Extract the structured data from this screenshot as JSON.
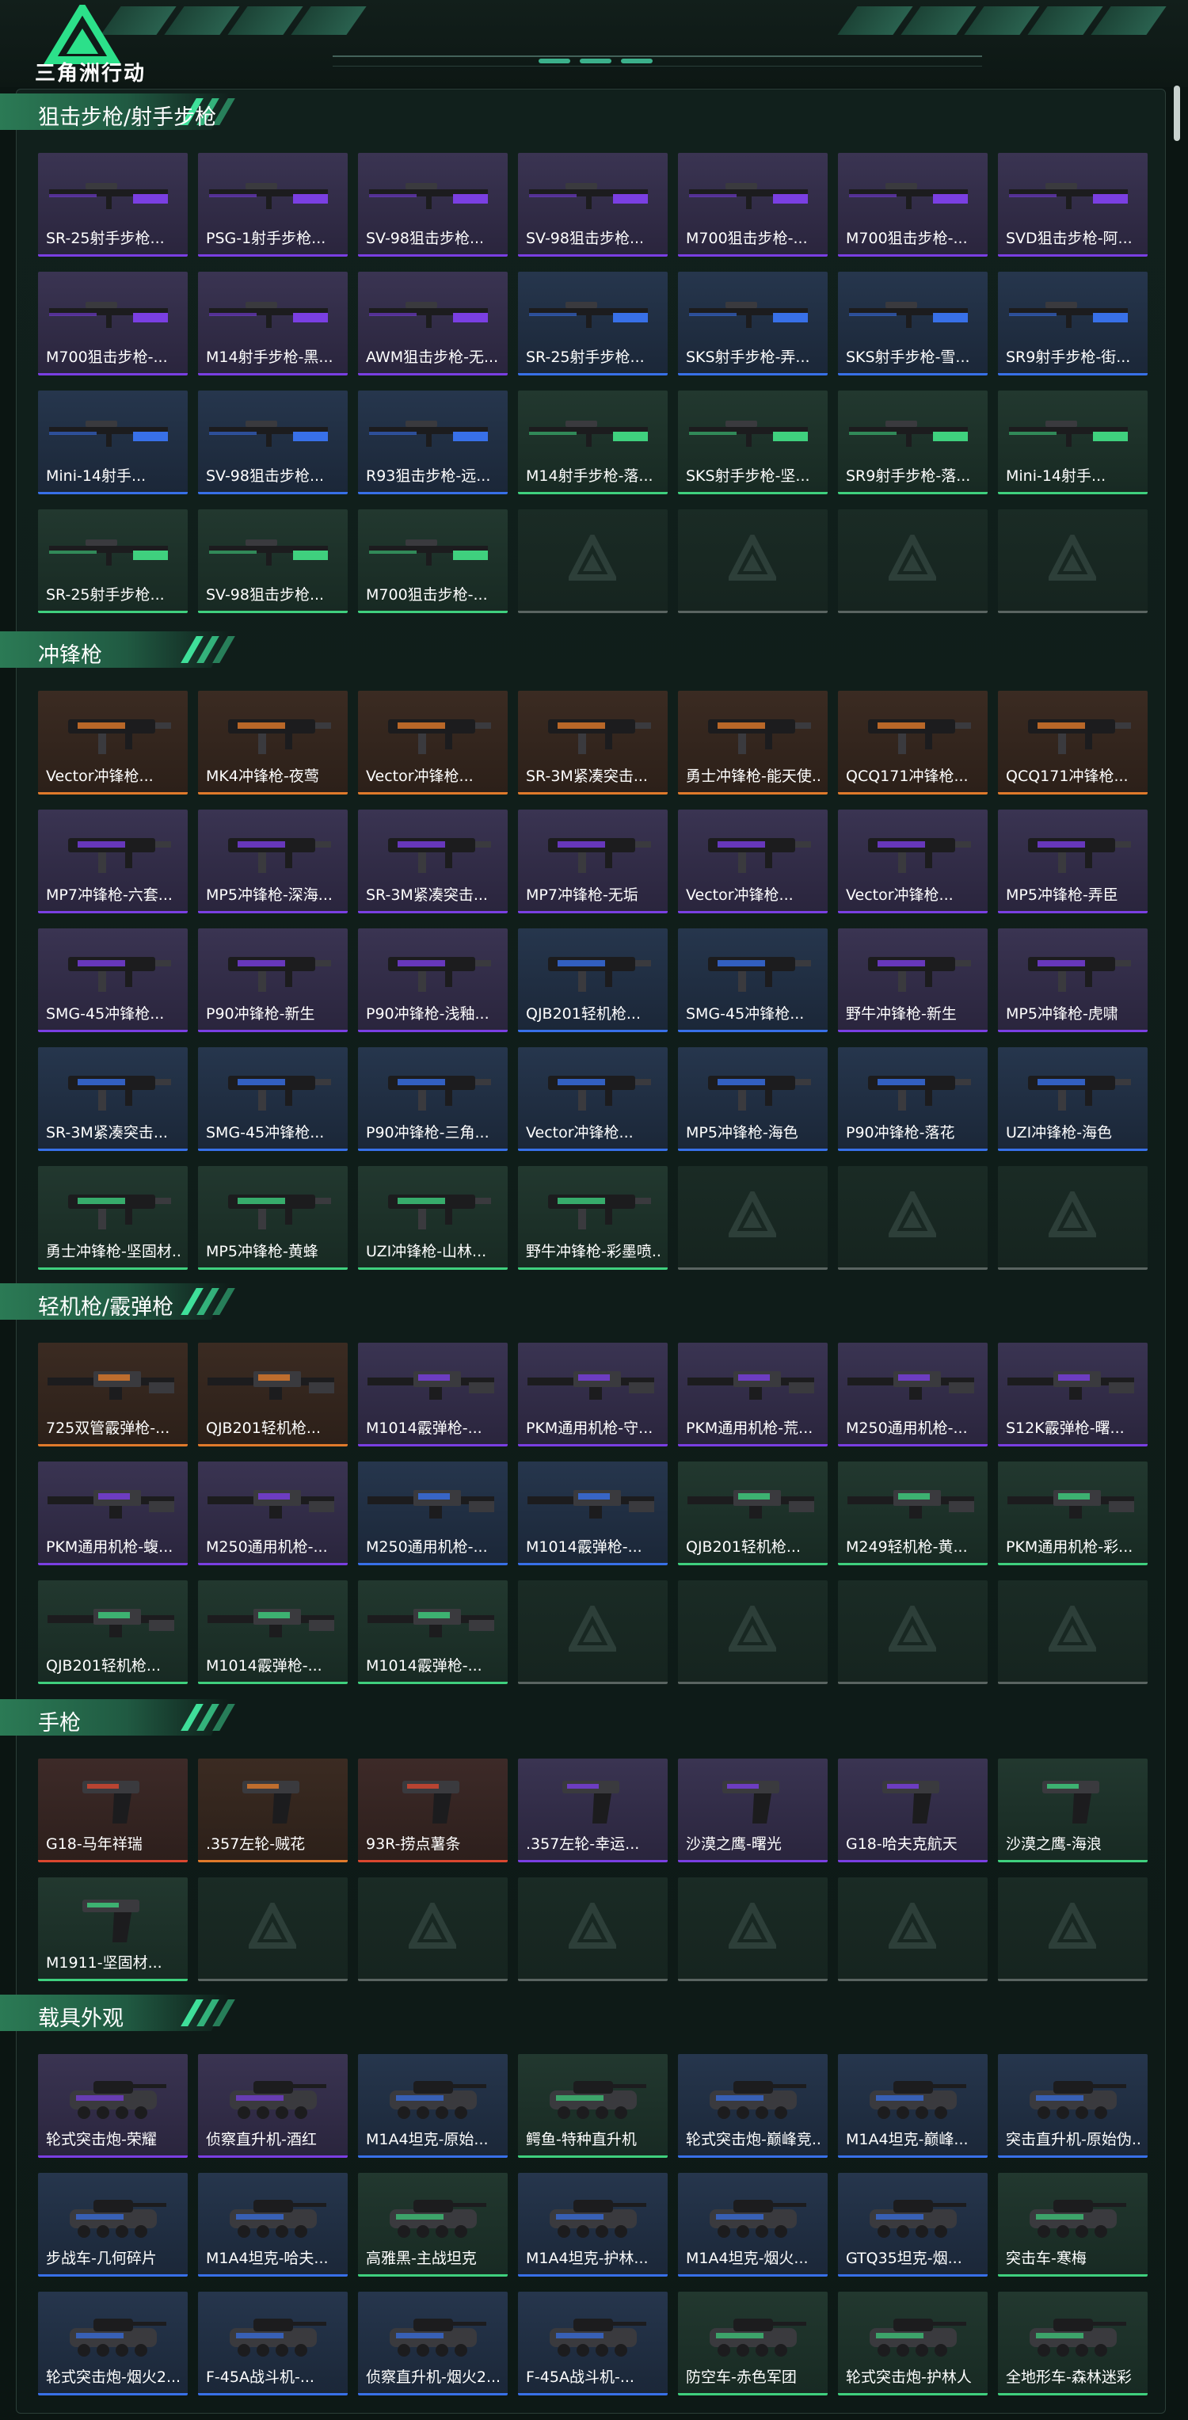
{
  "header": {
    "game_title": "三角洲行动",
    "logo_icon": "delta-logo-icon"
  },
  "sections": [
    {
      "title": "狙击步枪/射手步枪",
      "kind": "rifle",
      "columns": 7,
      "rows": 4,
      "items": [
        {
          "name": "SR-25射手步枪...",
          "rarity": "purple"
        },
        {
          "name": "PSG-1射手步枪...",
          "rarity": "purple"
        },
        {
          "name": "SV-98狙击步枪...",
          "rarity": "purple"
        },
        {
          "name": "SV-98狙击步枪...",
          "rarity": "purple"
        },
        {
          "name": "M700狙击步枪-...",
          "rarity": "purple"
        },
        {
          "name": "M700狙击步枪-...",
          "rarity": "purple"
        },
        {
          "name": "SVD狙击步枪-阿...",
          "rarity": "purple"
        },
        {
          "name": "M700狙击步枪-...",
          "rarity": "purple"
        },
        {
          "name": "M14射手步枪-黑...",
          "rarity": "purple"
        },
        {
          "name": "AWM狙击步枪-无...",
          "rarity": "purple"
        },
        {
          "name": "SR-25射手步枪...",
          "rarity": "blue"
        },
        {
          "name": "SKS射手步枪-弄...",
          "rarity": "blue"
        },
        {
          "name": "SKS射手步枪-雪...",
          "rarity": "blue"
        },
        {
          "name": "SR9射手步枪-街...",
          "rarity": "blue"
        },
        {
          "name": "Mini-14射手...",
          "rarity": "blue"
        },
        {
          "name": "SV-98狙击步枪...",
          "rarity": "blue"
        },
        {
          "name": "R93狙击步枪-远...",
          "rarity": "blue"
        },
        {
          "name": "M14射手步枪-落...",
          "rarity": "green"
        },
        {
          "name": "SKS射手步枪-坚...",
          "rarity": "green"
        },
        {
          "name": "SR9射手步枪-落...",
          "rarity": "green"
        },
        {
          "name": "Mini-14射手...",
          "rarity": "green"
        },
        {
          "name": "SR-25射手步枪...",
          "rarity": "green"
        },
        {
          "name": "SV-98狙击步枪...",
          "rarity": "green"
        },
        {
          "name": "M700狙击步枪-...",
          "rarity": "green"
        }
      ]
    },
    {
      "title": "冲锋枪",
      "kind": "smg",
      "columns": 7,
      "rows": 5,
      "items": [
        {
          "name": "Vector冲锋枪...",
          "rarity": "orange"
        },
        {
          "name": "MK4冲锋枪-夜莺",
          "rarity": "orange"
        },
        {
          "name": "Vector冲锋枪...",
          "rarity": "orange"
        },
        {
          "name": "SR-3M紧凑突击...",
          "rarity": "orange"
        },
        {
          "name": "勇士冲锋枪-能天使...",
          "rarity": "orange"
        },
        {
          "name": "QCQ171冲锋枪...",
          "rarity": "orange"
        },
        {
          "name": "QCQ171冲锋枪...",
          "rarity": "orange"
        },
        {
          "name": "MP7冲锋枪-六套...",
          "rarity": "purple"
        },
        {
          "name": "MP5冲锋枪-深海...",
          "rarity": "purple"
        },
        {
          "name": "SR-3M紧凑突击...",
          "rarity": "purple"
        },
        {
          "name": "MP7冲锋枪-无垢",
          "rarity": "purple"
        },
        {
          "name": "Vector冲锋枪...",
          "rarity": "purple"
        },
        {
          "name": "Vector冲锋枪...",
          "rarity": "purple"
        },
        {
          "name": "MP5冲锋枪-弄臣",
          "rarity": "purple"
        },
        {
          "name": "SMG-45冲锋枪...",
          "rarity": "purple"
        },
        {
          "name": "P90冲锋枪-新生",
          "rarity": "purple"
        },
        {
          "name": "P90冲锋枪-浅釉...",
          "rarity": "purple"
        },
        {
          "name": "QJB201轻机枪...",
          "rarity": "blue"
        },
        {
          "name": "SMG-45冲锋枪...",
          "rarity": "blue"
        },
        {
          "name": "野牛冲锋枪-新生",
          "rarity": "purple"
        },
        {
          "name": "MP5冲锋枪-虎啸",
          "rarity": "purple"
        },
        {
          "name": "SR-3M紧凑突击...",
          "rarity": "blue"
        },
        {
          "name": "SMG-45冲锋枪...",
          "rarity": "blue"
        },
        {
          "name": "P90冲锋枪-三角...",
          "rarity": "blue"
        },
        {
          "name": "Vector冲锋枪...",
          "rarity": "blue"
        },
        {
          "name": "MP5冲锋枪-海色",
          "rarity": "blue"
        },
        {
          "name": "P90冲锋枪-落花",
          "rarity": "blue"
        },
        {
          "name": "UZI冲锋枪-海色",
          "rarity": "blue"
        },
        {
          "name": "勇士冲锋枪-坚固材...",
          "rarity": "green"
        },
        {
          "name": "MP5冲锋枪-黄蜂",
          "rarity": "green"
        },
        {
          "name": "UZI冲锋枪-山林...",
          "rarity": "green"
        },
        {
          "name": "野牛冲锋枪-彩墨喷...",
          "rarity": "green"
        }
      ]
    },
    {
      "title": "轻机枪/霰弹枪",
      "kind": "lmg",
      "columns": 7,
      "rows": 3,
      "items": [
        {
          "name": "725双管霰弹枪-...",
          "rarity": "orange"
        },
        {
          "name": "QJB201轻机枪...",
          "rarity": "orange"
        },
        {
          "name": "M1014霰弹枪-...",
          "rarity": "purple"
        },
        {
          "name": "PKM通用机枪-守...",
          "rarity": "purple"
        },
        {
          "name": "PKM通用机枪-荒...",
          "rarity": "purple"
        },
        {
          "name": "M250通用机枪-...",
          "rarity": "purple"
        },
        {
          "name": "S12K霰弹枪-曙...",
          "rarity": "purple"
        },
        {
          "name": "PKM通用机枪-蝮...",
          "rarity": "purple"
        },
        {
          "name": "M250通用机枪-...",
          "rarity": "purple"
        },
        {
          "name": "M250通用机枪-...",
          "rarity": "blue"
        },
        {
          "name": "M1014霰弹枪-...",
          "rarity": "blue"
        },
        {
          "name": "QJB201轻机枪...",
          "rarity": "green"
        },
        {
          "name": "M249轻机枪-黄...",
          "rarity": "green"
        },
        {
          "name": "PKM通用机枪-彩...",
          "rarity": "green"
        },
        {
          "name": "QJB201轻机枪...",
          "rarity": "green"
        },
        {
          "name": "M1014霰弹枪-...",
          "rarity": "green"
        },
        {
          "name": "M1014霰弹枪-...",
          "rarity": "green"
        }
      ]
    },
    {
      "title": "手枪",
      "kind": "pistol",
      "columns": 7,
      "rows": 2,
      "items": [
        {
          "name": "G18-马年祥瑞",
          "rarity": "red"
        },
        {
          "name": ".357左轮-贼花",
          "rarity": "orange"
        },
        {
          "name": "93R-捞点薯条",
          "rarity": "red"
        },
        {
          "name": ".357左轮-幸运...",
          "rarity": "purple"
        },
        {
          "name": "沙漠之鹰-曙光",
          "rarity": "purple"
        },
        {
          "name": "G18-哈夫克航天",
          "rarity": "purple"
        },
        {
          "name": "沙漠之鹰-海浪",
          "rarity": "green"
        },
        {
          "name": "M1911-坚固材...",
          "rarity": "green"
        }
      ]
    },
    {
      "title": "载具外观",
      "kind": "vehicle",
      "columns": 7,
      "rows": 3,
      "items": [
        {
          "name": "轮式突击炮-荣耀",
          "rarity": "purple"
        },
        {
          "name": "侦察直升机-酒红",
          "rarity": "purple"
        },
        {
          "name": "M1A4坦克-原始...",
          "rarity": "blue"
        },
        {
          "name": "鳄鱼-特种直升机",
          "rarity": "green"
        },
        {
          "name": "轮式突击炮-巅峰竞...",
          "rarity": "blue"
        },
        {
          "name": "M1A4坦克-巅峰...",
          "rarity": "blue"
        },
        {
          "name": "突击直升机-原始伪...",
          "rarity": "blue"
        },
        {
          "name": "步战车-几何碎片",
          "rarity": "blue"
        },
        {
          "name": "M1A4坦克-哈夫...",
          "rarity": "blue"
        },
        {
          "name": "高雅黑-主战坦克",
          "rarity": "green"
        },
        {
          "name": "M1A4坦克-护林...",
          "rarity": "blue"
        },
        {
          "name": "M1A4坦克-烟火...",
          "rarity": "blue"
        },
        {
          "name": "GTQ35坦克-烟...",
          "rarity": "blue"
        },
        {
          "name": "突击车-寒梅",
          "rarity": "green"
        },
        {
          "name": "轮式突击炮-烟火2...",
          "rarity": "blue"
        },
        {
          "name": "F-45A战斗机-...",
          "rarity": "blue"
        },
        {
          "name": "侦察直升机-烟火2...",
          "rarity": "blue"
        },
        {
          "name": "F-45A战斗机-...",
          "rarity": "blue"
        },
        {
          "name": "防空车-赤色军团",
          "rarity": "green"
        },
        {
          "name": "轮式突击炮-护林人",
          "rarity": "green"
        },
        {
          "name": "全地形车-森林迷彩",
          "rarity": "green"
        }
      ]
    }
  ],
  "icons": {
    "placeholder": "delta-watermark-icon",
    "rifle": "rifle-icon",
    "smg": "smg-icon",
    "lmg": "machine-gun-icon",
    "pistol": "pistol-icon",
    "vehicle": "vehicle-icon"
  },
  "colors": {
    "purple": "#7a3fe2",
    "blue": "#3870e8",
    "green": "#3fd07e",
    "orange": "#e07a2b",
    "red": "#d9472f",
    "section_accent": "#3fe09a"
  }
}
